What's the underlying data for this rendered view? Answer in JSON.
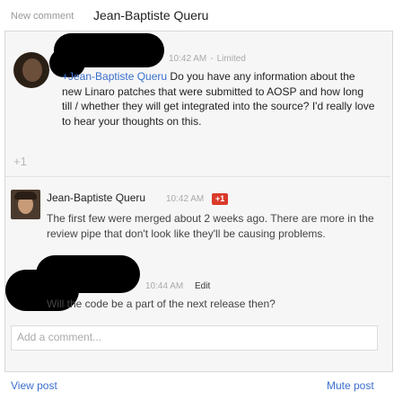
{
  "header": {
    "label": "New comment",
    "name": "Jean-Baptiste Queru"
  },
  "comments": [
    {
      "mention": "+Jean-Baptiste Queru",
      "text": " Do you have any information about the new Linaro patches that were submitted to AOSP and how long till / whether they will get integrated into the source? I'd really love to hear your thoughts on this.",
      "time": "10:42 AM",
      "visibility": "Limited"
    },
    {
      "author": "Jean-Baptiste Queru",
      "time": "10:42 AM",
      "badge": "+1",
      "text": "The first few were merged about 2 weeks ago. There are more in the review pipe that don't look like they'll be causing problems."
    },
    {
      "time": "10:44 AM",
      "edit_label": "Edit",
      "text": "Will the code be a part of the next release then?"
    }
  ],
  "plusone": {
    "label": "+1"
  },
  "add_comment": {
    "placeholder": "Add a comment..."
  },
  "footer": {
    "view_post": "View post",
    "mute_post": "Mute post"
  },
  "colors": {
    "link": "#3a6fcd",
    "badge": "#d93b2b",
    "panel": "#f6f6f6"
  }
}
